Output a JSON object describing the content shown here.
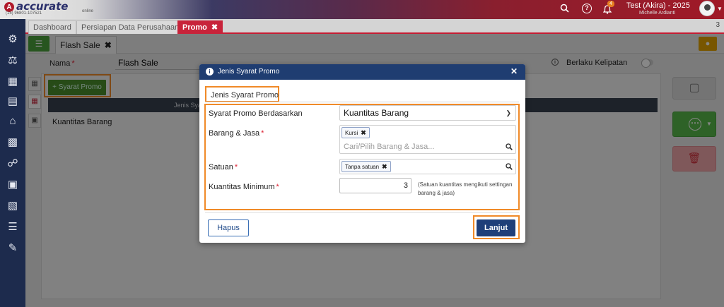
{
  "header": {
    "logo_text": "accurate",
    "logo_tagline": "(15) 96801-107521",
    "logo_online": "online",
    "notif_count": "4",
    "user_name": "Test (Akira) - 2025",
    "user_sub": "Michelle Ardianti"
  },
  "tabs": [
    {
      "label": "Dashboard"
    },
    {
      "label": "Persiapan Data Perusahaan"
    },
    {
      "label": "Promo",
      "active": true
    }
  ],
  "tab_count": "3",
  "doc_tab": {
    "label": "Flash Sale"
  },
  "form": {
    "nama_label": "Nama",
    "nama_value": "Flash Sale",
    "berlaku_label": "Berlaku Kelipatan"
  },
  "main": {
    "syarat_button": "+ Syarat Promo",
    "grid_header": "Jenis Syar",
    "rows": [
      {
        "text": "Kuantitas Barang"
      }
    ]
  },
  "modal": {
    "title": "Jenis Syarat Promo",
    "section_title": "Jenis Syarat Promo",
    "fields": {
      "syarat_label": "Syarat Promo Berdasarkan",
      "syarat_value": "Kuantitas Barang",
      "barang_label": "Barang & Jasa",
      "barang_chip": "Kursi",
      "barang_placeholder": "Cari/Pilih Barang & Jasa...",
      "satuan_label": "Satuan",
      "satuan_chip": "Tanpa satuan",
      "qty_label": "Kuantitas Minimum",
      "qty_value": "3",
      "qty_note": "(Satuan kuantitas mengikuti settingan barang & jasa)"
    },
    "buttons": {
      "hapus": "Hapus",
      "lanjut": "Lanjut"
    }
  },
  "colors": {
    "accent": "#c8233a",
    "primary": "#1f3d71",
    "highlight": "#f08a28",
    "success": "#4aa03b"
  },
  "icons": [
    "search-icon",
    "help-icon",
    "bell-icon",
    "gear-icon",
    "info-icon",
    "close-icon",
    "save-icon",
    "more-icon",
    "trash-icon",
    "lightbulb-icon",
    "list-icon"
  ]
}
